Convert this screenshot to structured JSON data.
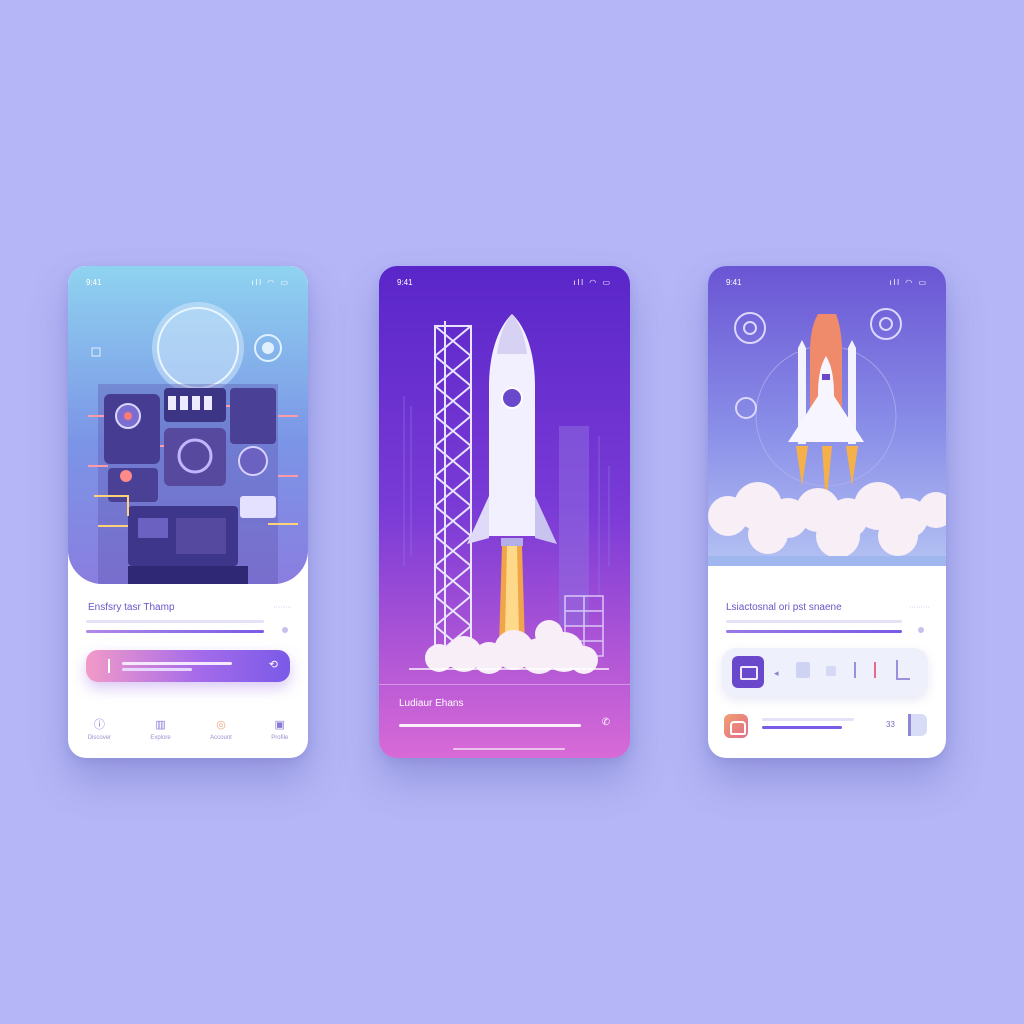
{
  "phone1": {
    "status": {
      "time": "9:41",
      "signal": "ıll ◠ ▭"
    },
    "app_title": "Ensfsry tasr Thamp",
    "small_label": "········",
    "nav": [
      {
        "icon": "info-icon",
        "glyph": "ⓘ",
        "label": "Discover"
      },
      {
        "icon": "book-icon",
        "glyph": "▥",
        "label": "Explore"
      },
      {
        "icon": "compass-icon",
        "glyph": "◎",
        "label": "Account"
      },
      {
        "icon": "folder-icon",
        "glyph": "▣",
        "label": "Profile"
      }
    ]
  },
  "phone2": {
    "status": {
      "time": "9:41",
      "signal": "ıll ◠ ▭"
    },
    "app_title": "Ludiaur Ehans"
  },
  "phone3": {
    "status": {
      "time": "9:41",
      "signal": "ıll ◠ ▭"
    },
    "app_title": "Lsiactosnal ori pst snaene",
    "small_label": "·········",
    "badge": "33"
  },
  "colors": {
    "background": "#b4b6f7",
    "accent_purple": "#7a5ae8",
    "accent_pink": "#f29ac8"
  }
}
